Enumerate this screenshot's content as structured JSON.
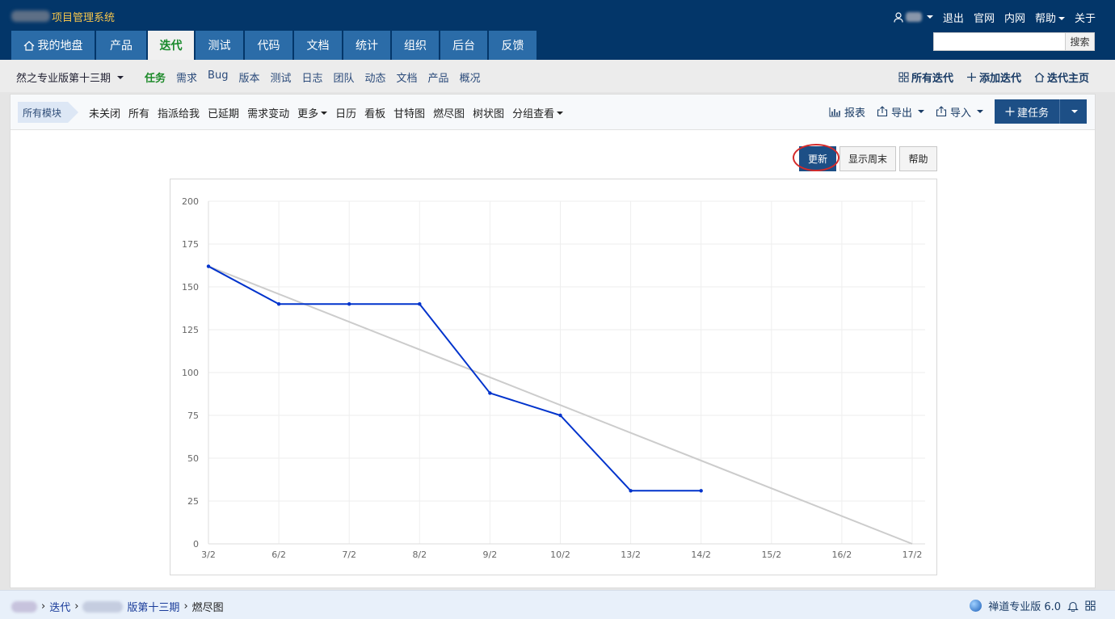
{
  "app": {
    "title": "项目管理系统"
  },
  "topnav": [
    "退出",
    "官网",
    "内网",
    "帮助",
    "关于"
  ],
  "search": {
    "button": "搜索",
    "placeholder": ""
  },
  "main_nav": [
    {
      "label": "我的地盘",
      "active": false
    },
    {
      "label": "产品",
      "active": false
    },
    {
      "label": "迭代",
      "active": true
    },
    {
      "label": "测试",
      "active": false
    },
    {
      "label": "代码",
      "active": false
    },
    {
      "label": "文档",
      "active": false
    },
    {
      "label": "统计",
      "active": false
    },
    {
      "label": "组织",
      "active": false
    },
    {
      "label": "后台",
      "active": false
    },
    {
      "label": "反馈",
      "active": false
    }
  ],
  "subnav": {
    "project": "然之专业版第十三期",
    "links": [
      "任务",
      "需求",
      "Bug",
      "版本",
      "测试",
      "日志",
      "团队",
      "动态",
      "文档",
      "产品",
      "概况"
    ],
    "active": "任务",
    "right": [
      "所有迭代",
      "添加迭代",
      "迭代主页"
    ]
  },
  "featurebar": {
    "module": "所有模块",
    "filters": [
      "未关闭",
      "所有",
      "指派给我",
      "已延期",
      "需求变动",
      "更多",
      "日历",
      "看板",
      "甘特图",
      "燃尽图",
      "树状图",
      "分组查看"
    ],
    "actions": [
      "报表",
      "导出",
      "导入"
    ],
    "new_task": "建任务"
  },
  "buttons": {
    "update": "更新",
    "show_weekend": "显示周末",
    "help": "帮助"
  },
  "chart_data": {
    "type": "line",
    "categories": [
      "3/2",
      "6/2",
      "7/2",
      "8/2",
      "9/2",
      "10/2",
      "13/2",
      "14/2",
      "15/2",
      "16/2",
      "17/2"
    ],
    "ylim": [
      0,
      200
    ],
    "yticks": [
      0,
      25,
      50,
      75,
      100,
      125,
      150,
      175,
      200
    ],
    "grid": true,
    "series": [
      {
        "values": [
          162,
          162,
          null,
          null,
          null,
          null,
          null,
          null,
          null,
          null,
          0
        ],
        "color": "#cccccc",
        "kind": "ideal"
      },
      {
        "values": [
          162,
          140,
          140,
          140,
          88,
          75,
          31,
          31,
          null,
          null,
          null
        ],
        "color": "#0033cc",
        "kind": "actual"
      }
    ]
  },
  "footer": {
    "crumbs": [
      "迭代",
      "版第十三期",
      "燃尽图"
    ],
    "version": "禅道专业版 6.0"
  }
}
